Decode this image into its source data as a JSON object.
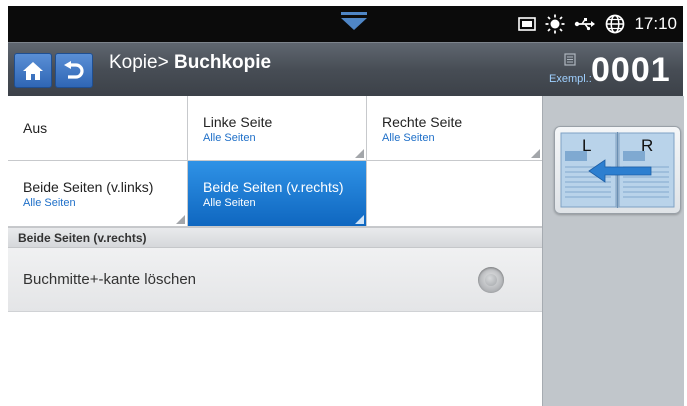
{
  "status_bar": {
    "time": "17:10",
    "icons": [
      "pull-down-tab-icon",
      "memory-card-icon",
      "sun-icon",
      "usb-icon",
      "globe-icon"
    ]
  },
  "title_bar": {
    "path": "Kopie>",
    "title": "Buchkopie",
    "copies_label": "Exempl.:",
    "copies_value": "0001"
  },
  "options": [
    {
      "label": "Aus",
      "sub": "",
      "selected": false
    },
    {
      "label": "Linke Seite",
      "sub": "Alle Seiten",
      "selected": false
    },
    {
      "label": "Rechte Seite",
      "sub": "Alle Seiten",
      "selected": false
    },
    {
      "label": "Beide Seiten (v.links)",
      "sub": "Alle Seiten",
      "selected": false
    },
    {
      "label": "Beide Seiten (v.rechts)",
      "sub": "Alle Seiten",
      "selected": true
    }
  ],
  "section": {
    "header": "Beide Seiten (v.rechts)",
    "toggle_label": "Buchmitte+-kante löschen",
    "toggle_on": false
  },
  "preview": {
    "left_letter": "L",
    "right_letter": "R"
  },
  "colors": {
    "accent": "#1a7ad6",
    "selected_bg": "#0f67c0",
    "sub_text": "#1e6fc8",
    "title_bar": "#474d55"
  }
}
